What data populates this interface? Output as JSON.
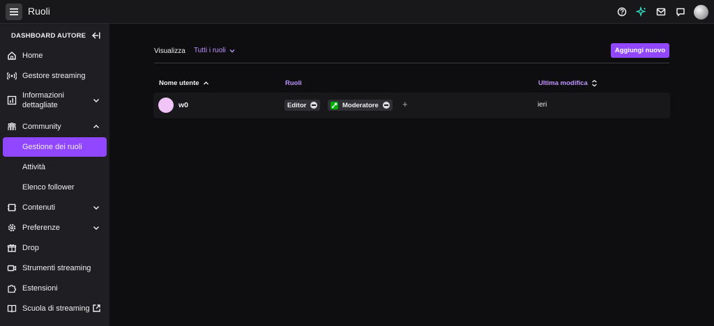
{
  "header": {
    "title": "Ruoli",
    "icons": [
      "help-icon",
      "sparkle-icon",
      "inbox-icon",
      "whispers-icon",
      "user-avatar"
    ],
    "colors": {
      "bar": "#18181b",
      "sparkle": "#34e0c6"
    }
  },
  "sidebar": {
    "title": "DASHBOARD AUTORE",
    "items": [
      {
        "label": "Home",
        "icon": "home-icon"
      },
      {
        "label": "Gestore streaming",
        "icon": "broadcast-icon"
      },
      {
        "label": "Informazioni dettagliate",
        "icon": "insights-icon",
        "expandable": true
      },
      {
        "label": "Community",
        "icon": "community-icon",
        "expanded": true
      },
      {
        "label": "Gestione dei ruoli",
        "active": true
      },
      {
        "label": "Attività"
      },
      {
        "label": "Elenco follower"
      },
      {
        "label": "Contenuti",
        "icon": "content-icon",
        "expandable": true
      },
      {
        "label": "Preferenze",
        "icon": "gear-icon",
        "expandable": true
      },
      {
        "label": "Drop",
        "icon": "gift-icon"
      },
      {
        "label": "Strumenti streaming",
        "icon": "camera-icon"
      },
      {
        "label": "Estensioni",
        "icon": "puzzle-icon"
      },
      {
        "label": "Scuola di streaming",
        "icon": "book-icon",
        "external": true
      }
    ],
    "accent": "#9147ff"
  },
  "main": {
    "filter_label": "Visualizza",
    "filter_value": "Tutti i ruoli",
    "add_button": "Aggiungi nuovo",
    "table": {
      "columns": [
        "Nome utente",
        "Ruoli",
        "Ultima modifica"
      ],
      "rows": [
        {
          "user": "w0",
          "roles": [
            "Editor",
            "Moderatore"
          ],
          "modified": "ieri"
        }
      ]
    }
  }
}
